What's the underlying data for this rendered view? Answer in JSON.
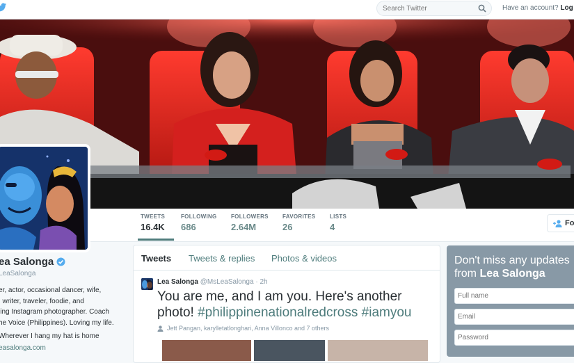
{
  "topbar": {
    "search_placeholder": "Search Twitter",
    "have_account": "Have an account?",
    "login": "Log in"
  },
  "nav": {
    "stats": [
      {
        "label": "TWEETS",
        "value": "16.4K"
      },
      {
        "label": "FOLLOWING",
        "value": "686"
      },
      {
        "label": "FOLLOWERS",
        "value": "2.64M"
      },
      {
        "label": "FAVORITES",
        "value": "26"
      },
      {
        "label": "LISTS",
        "value": "4"
      }
    ],
    "follow_label": "Fo"
  },
  "profile": {
    "name": "ea Salonga",
    "handle": "LeaSalonga",
    "bio_lines": [
      "er, actor, occasional dancer, wife,",
      ", writer, traveler, foodie, and",
      "ling Instagram photographer. Coach",
      "he Voice (Philippines). Loving my life."
    ],
    "location": "Wherever I hang my hat is home",
    "website": "easalonga.com"
  },
  "timeline": {
    "tabs": [
      "Tweets",
      "Tweets & replies",
      "Photos & videos"
    ],
    "tweet": {
      "author": "Lea Salonga",
      "handle": "@MsLeaSalonga",
      "time": "· 2h",
      "text_plain": "You are me, and I am you. Here's another photo! ",
      "hashtag1": "#philippinenationalredcross",
      "hashtag2": "#iamyou",
      "tagged": "Jett Pangan, karylletatlonghari, Anna Villonco and 7 others"
    }
  },
  "signup": {
    "heading_line1": "Don't miss any updates",
    "heading_from": "from ",
    "heading_name": "Lea Salonga",
    "fullname_placeholder": "Full name",
    "email_placeholder": "Email",
    "password_placeholder": "Password"
  }
}
